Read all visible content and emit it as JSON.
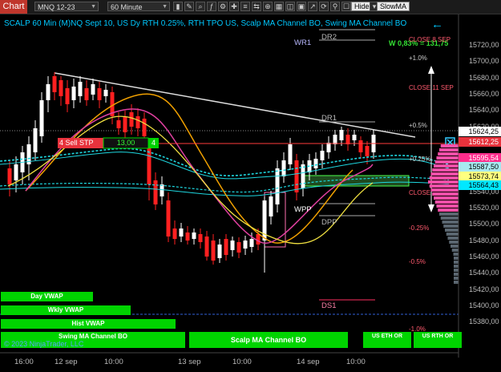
{
  "toolbar": {
    "tab": "Chart",
    "instrument": "MNQ 12-23",
    "interval": "60 Minute",
    "hide_label": "Hide",
    "indicator_label": "SlowMA"
  },
  "chart": {
    "title": "SCALP 60 Min (M)NQ Sept 10, US Dy RTH 0.25%, RTH TPO US, Scalp MA Channel BO, Swing MA Channel BO",
    "volume_label": "W 0,83% = 131,75",
    "price_axis": [
      "15720,00",
      "15700,00",
      "15680,00",
      "15660,00",
      "15640,00",
      "15620,00",
      "15600,00",
      "15580,00",
      "15560,00",
      "15540,00",
      "15520,00",
      "15500,00",
      "15480,00",
      "15460,00",
      "15440,00",
      "15420,00",
      "15400,00",
      "15380,00"
    ],
    "price_tags": [
      {
        "text": "15624,25",
        "bg": "#ffffff",
        "fg": "#000000"
      },
      {
        "text": "15612,25",
        "bg": "#e8323c",
        "fg": "#ffffff"
      },
      {
        "text": "15595,54",
        "bg": "#ff2d8c",
        "fg": "#ffffff"
      },
      {
        "text": "15587,50",
        "bg": "#a7e8f0",
        "fg": "#000000"
      },
      {
        "text": "15573,74",
        "bg": "#ffff80",
        "fg": "#000000"
      },
      {
        "text": "15564,43",
        "bg": "#00e8ff",
        "fg": "#000000"
      }
    ],
    "time_axis": [
      "16:00",
      "12 sep",
      "10:00",
      "13 sep",
      "10:00",
      "14 sep",
      "10:00"
    ],
    "levels": {
      "dr2": "DR2",
      "wr1": "WR1",
      "dr1": "DR1",
      "wpp": "WPP",
      "dpp": "DPP",
      "ds1": "DS1"
    },
    "percent_labels": {
      "close_prev": "CLOSE 8 SEP",
      "p1": "+1.0%",
      "close_11": "CLOSE 11 SEP",
      "p05": "+0.5%",
      "p025": "+0.25%",
      "close_low": "CLOSE",
      "m025": "-0.25%",
      "m05": "-0.5%",
      "m1": "-1.0%"
    },
    "order": {
      "label": "4  Sell STP",
      "price": "13,00",
      "qty": "4"
    },
    "vwap_bars": {
      "day": "Day VWAP",
      "wkly": "Wkly VWAP",
      "hist": "Hist VWAP",
      "swing": "Swing MA Channel BO",
      "scalp": "Scalp MA Channel BO",
      "eth": "US ETH OR",
      "rth": "US RTH OR"
    },
    "copyright": "© 2023 NinjaTrader, LLC"
  }
}
